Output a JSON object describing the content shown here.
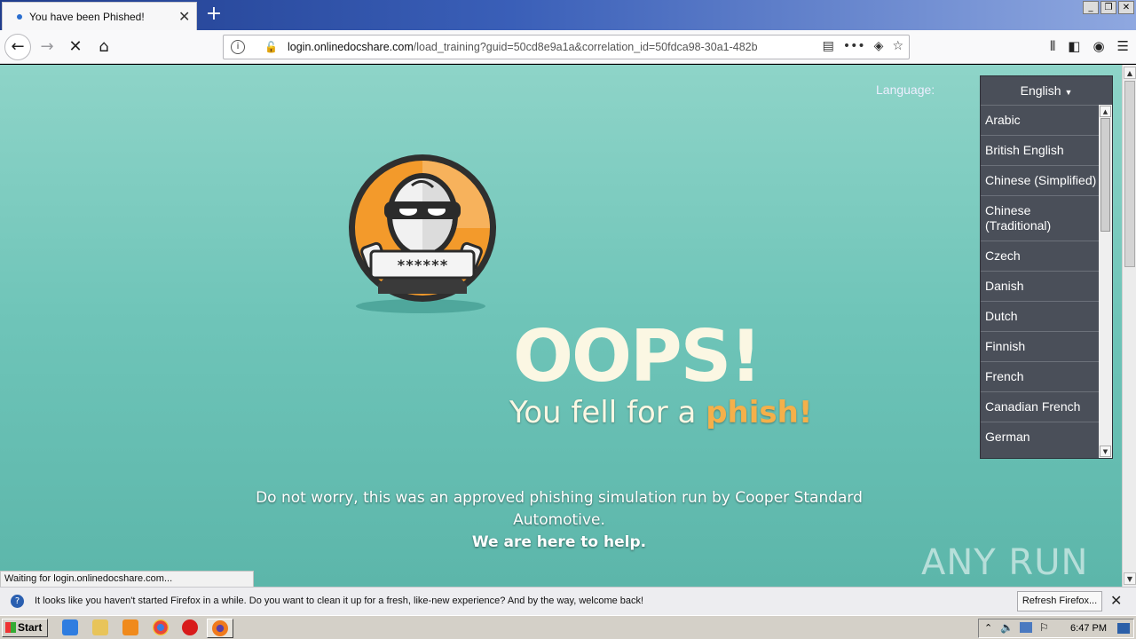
{
  "browser": {
    "tab_title": "You have been Phished!",
    "url_host": "login.onlinedocshare.com",
    "url_path": "/load_training?guid=50cd8e9a1a&correlation_id=50fdca98-30a1-482b",
    "status_text": "Waiting for login.onlinedocshare.com..."
  },
  "page": {
    "language_label": "Language:",
    "selected_language": "English",
    "languages": [
      "Arabic",
      "British English",
      "Chinese (Simplified)",
      "Chinese (Traditional)",
      "Czech",
      "Danish",
      "Dutch",
      "Finnish",
      "French",
      "Canadian French",
      "German"
    ],
    "mascot_password": "******",
    "headline": "OOPS!",
    "subheadline_prefix": "You fell for a ",
    "subheadline_highlight": "phish!",
    "description": "Do not worry, this was an approved phishing simulation run by Cooper Standard Automotive.",
    "help_text": "We are here to help.",
    "watermark": "ANY RUN"
  },
  "notification": {
    "message": "It looks like you haven't started Firefox in a while. Do you want to clean it up for a fresh, like-new experience? And by the way, welcome back!",
    "button_label": "Refresh Firefox..."
  },
  "taskbar": {
    "start_label": "Start",
    "clock": "6:47 PM"
  },
  "colors": {
    "background_teal": "#6ec4b8",
    "headline_cream": "#fbf7e3",
    "phish_orange": "#f4b04a",
    "dropdown_bg": "#4a4f59"
  }
}
